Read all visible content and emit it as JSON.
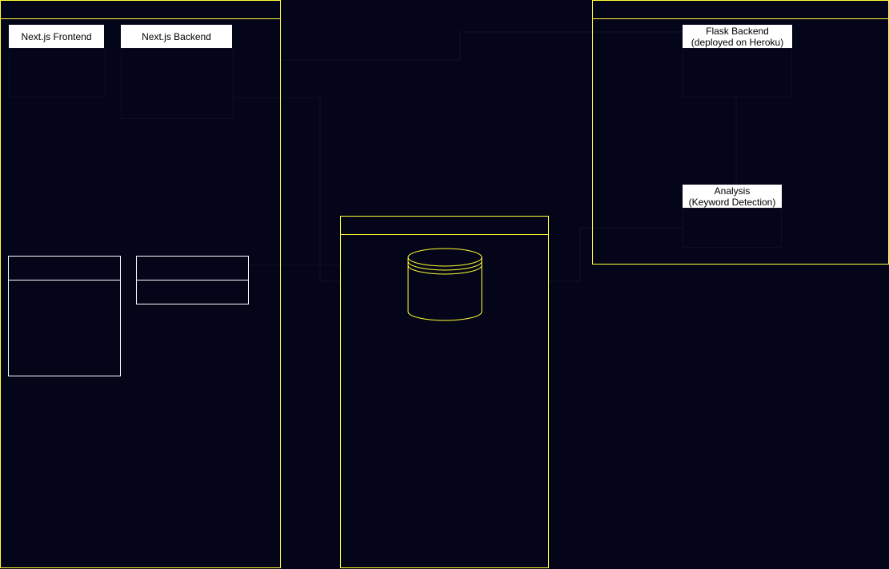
{
  "colors": {
    "background": "#05051a",
    "lane_border": "#ffff33",
    "box_fill": "#ffffff",
    "box_text": "#000000",
    "connector": "#0f0f2a"
  },
  "lanes": {
    "nextjs_lane": {
      "header": ""
    },
    "flask_lane": {
      "header": ""
    },
    "database_lane": {
      "header": ""
    }
  },
  "boxes": {
    "nextjs_frontend": {
      "title": "Next.js Frontend"
    },
    "nextjs_backend": {
      "title": "Next.js Backend"
    },
    "flask_backend": {
      "title_line1": "Flask Backend",
      "title_line2": "(deployed on Heroku)"
    },
    "analysis": {
      "title_line1": "Analysis",
      "title_line2": "(Keyword Detection)"
    }
  },
  "database": {
    "icon": "database-cylinder-icon"
  }
}
